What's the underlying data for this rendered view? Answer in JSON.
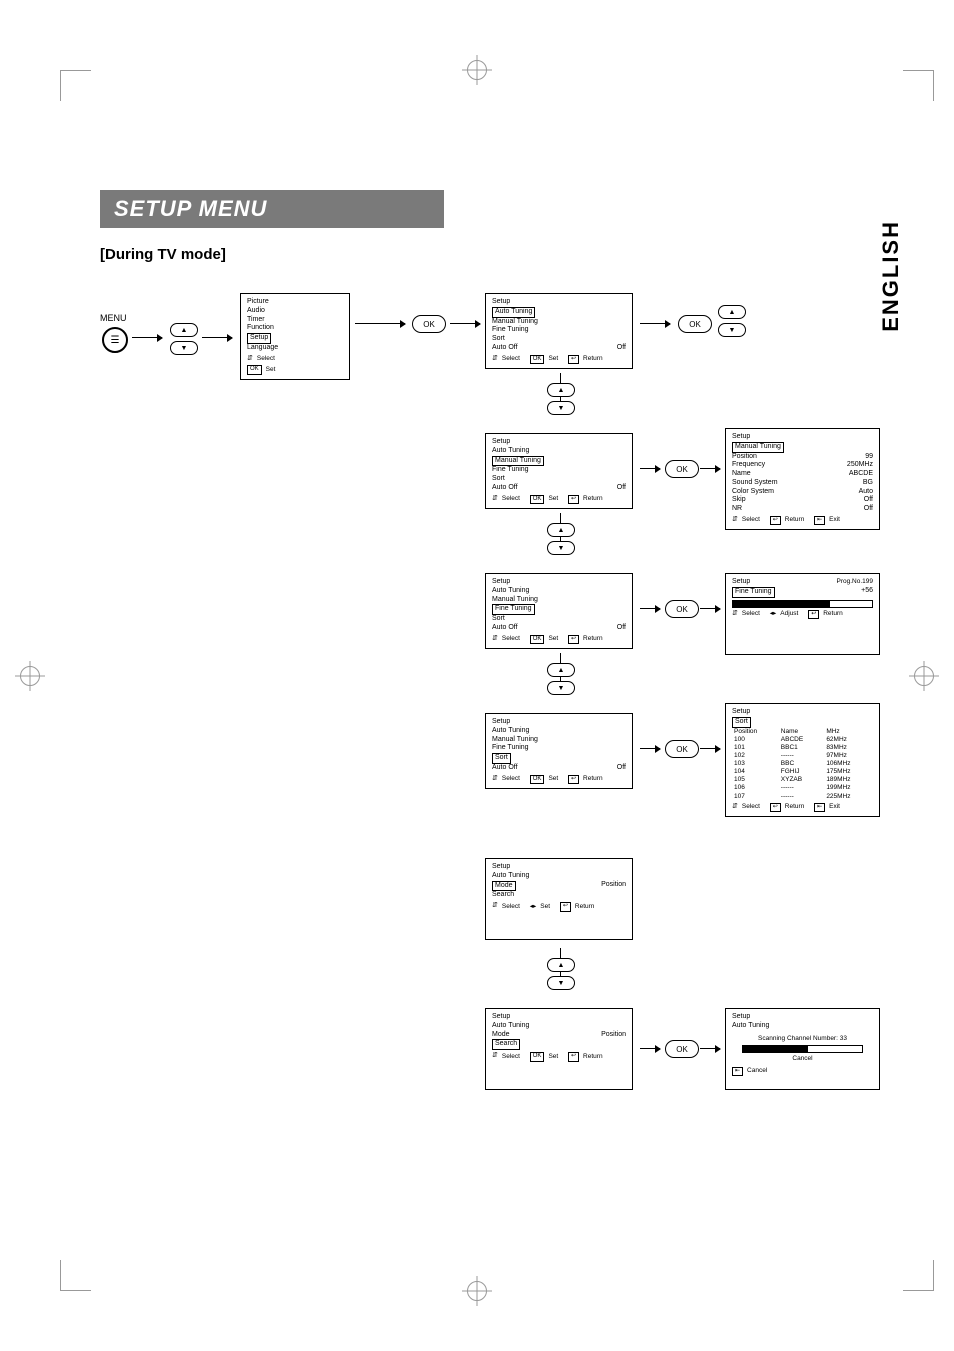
{
  "page": {
    "title": "SETUP MENU",
    "subheading": "[During TV mode]",
    "side_label": "ENGLISH"
  },
  "labels": {
    "menu": "MENU",
    "ok": "OK",
    "select": "Select",
    "set": "Set",
    "adjust": "Adjust",
    "return": "Return",
    "exit": "Exit",
    "cancel": "Cancel"
  },
  "main_menu": {
    "title": "",
    "items": [
      "Picture",
      "Audio",
      "Timer",
      "Function",
      "Setup",
      "Language"
    ],
    "selected": "Setup",
    "footer": [
      "Select",
      "Set"
    ]
  },
  "setup_menu": {
    "title": "Setup",
    "items": [
      {
        "label": "Auto Tuning",
        "value": ""
      },
      {
        "label": "Manual Tuning",
        "value": ""
      },
      {
        "label": "Fine Tuning",
        "value": ""
      },
      {
        "label": "Sort",
        "value": ""
      },
      {
        "label": "Auto Off",
        "value": "Off"
      }
    ]
  },
  "auto_tuning_detail": {
    "title": "Setup",
    "sub": "Auto Tuning",
    "items": [
      {
        "label": "Mode",
        "value": "Position"
      },
      {
        "label": "Search",
        "value": ""
      }
    ]
  },
  "scanning": {
    "title": "Setup",
    "sub": "Auto Tuning",
    "msg": "Scanning Channel Number: 33",
    "cancel": "Cancel"
  },
  "manual_tuning_detail": {
    "title": "Setup",
    "sub": "Manual Tuning",
    "rows": [
      {
        "label": "Position",
        "value": "99"
      },
      {
        "label": "Frequency",
        "value": "250MHz"
      },
      {
        "label": "Name",
        "value": "ABCDE"
      },
      {
        "label": "Sound System",
        "value": "BG"
      },
      {
        "label": "Color System",
        "value": "Auto"
      },
      {
        "label": "Skip",
        "value": "Off"
      },
      {
        "label": "NR",
        "value": "Off"
      }
    ]
  },
  "fine_tuning_detail": {
    "title": "Setup",
    "sub": "Fine Tuning",
    "prog": "Prog.No.199",
    "value": "+56",
    "percent": 70
  },
  "sort_detail": {
    "title": "Setup",
    "sub": "Sort",
    "cols": [
      "Position",
      "Name",
      "MHz"
    ],
    "rows": [
      {
        "pos": "100",
        "name": "ABCDE",
        "mhz": "62MHz"
      },
      {
        "pos": "101",
        "name": "BBC1",
        "mhz": "83MHz"
      },
      {
        "pos": "102",
        "name": "------",
        "mhz": "97MHz"
      },
      {
        "pos": "103",
        "name": "BBC",
        "mhz": "106MHz"
      },
      {
        "pos": "104",
        "name": "FGHIJ",
        "mhz": "175MHz"
      },
      {
        "pos": "105",
        "name": "XYZAB",
        "mhz": "189MHz"
      },
      {
        "pos": "106",
        "name": "------",
        "mhz": "199MHz"
      },
      {
        "pos": "107",
        "name": "------",
        "mhz": "225MHz"
      }
    ]
  }
}
